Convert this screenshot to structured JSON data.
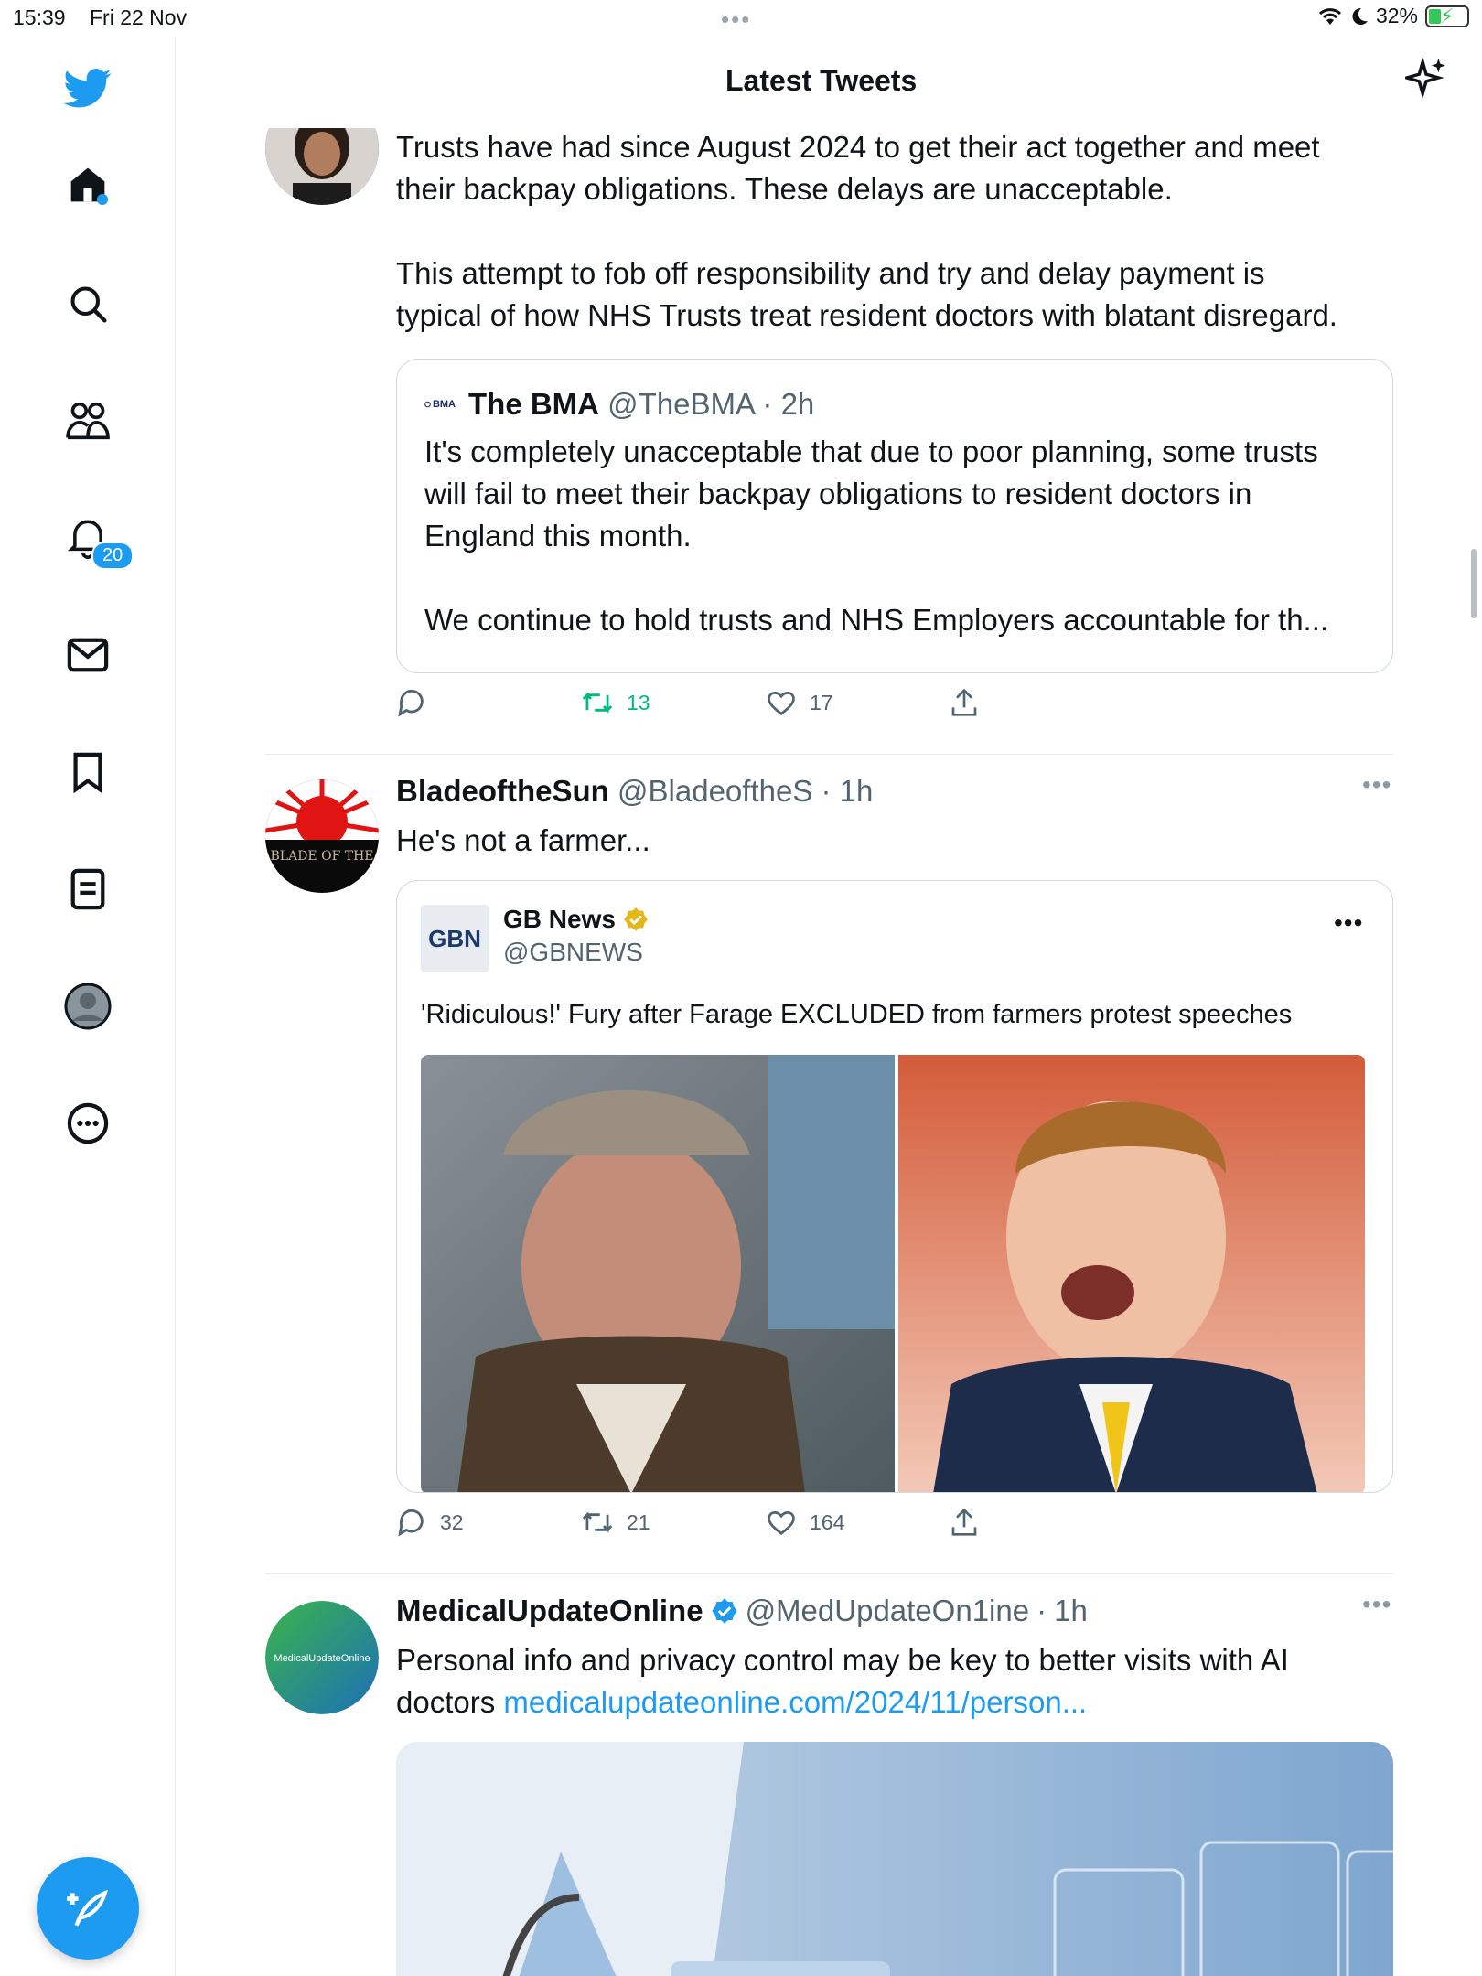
{
  "status_bar": {
    "time": "15:39",
    "date": "Fri 22 Nov",
    "battery": "32%"
  },
  "header": {
    "title": "Latest Tweets"
  },
  "sidebar": {
    "notifications_badge": "20"
  },
  "tweets": [
    {
      "text_lines": [
        "Trusts have had since August 2024 to get their act together and meet",
        "their backpay obligations. These delays are unacceptable.",
        "",
        "This attempt to fob off responsibility and try and delay payment is",
        "typical of how NHS Trusts treat resident doctors with blatant disregard."
      ],
      "quote": {
        "logo_text": "BMA",
        "name": "The BMA",
        "handle": "@TheBMA",
        "time": "2h",
        "text_lines": [
          "It's completely unacceptable that due to poor planning, some trusts",
          "will fail to meet their backpay obligations to resident doctors in",
          "England this month.",
          "",
          "We continue to hold trusts and NHS Employers accountable for th..."
        ]
      },
      "actions": {
        "reply": "",
        "retweet": "13",
        "like": "17"
      }
    },
    {
      "name": "BladeoftheSun",
      "handle": "@BladeoftheS",
      "time": "1h",
      "text": "He's not a farmer...",
      "avatar_text": "BLADE OF THE",
      "quote": {
        "logo_text": "GBN",
        "name": "GB News",
        "handle": "@GBNEWS",
        "text": "'Ridiculous!' Fury after Farage EXCLUDED from farmers protest speeches"
      },
      "actions": {
        "reply": "32",
        "retweet": "21",
        "like": "164"
      }
    },
    {
      "name": "MedicalUpdateOnline",
      "handle": "@MedUpdateOn1ine",
      "time": "1h",
      "text_line1": "Personal info and privacy control may be key to better visits with AI",
      "text_line2_prefix": "doctors ",
      "link": "medicalupdateonline.com/2024/11/person...",
      "avatar_text": "MedicalUpdateOnline"
    }
  ],
  "colors": {
    "accent": "#1d9bf0",
    "retweet_active": "#00ba7c",
    "text_secondary": "#536471"
  }
}
